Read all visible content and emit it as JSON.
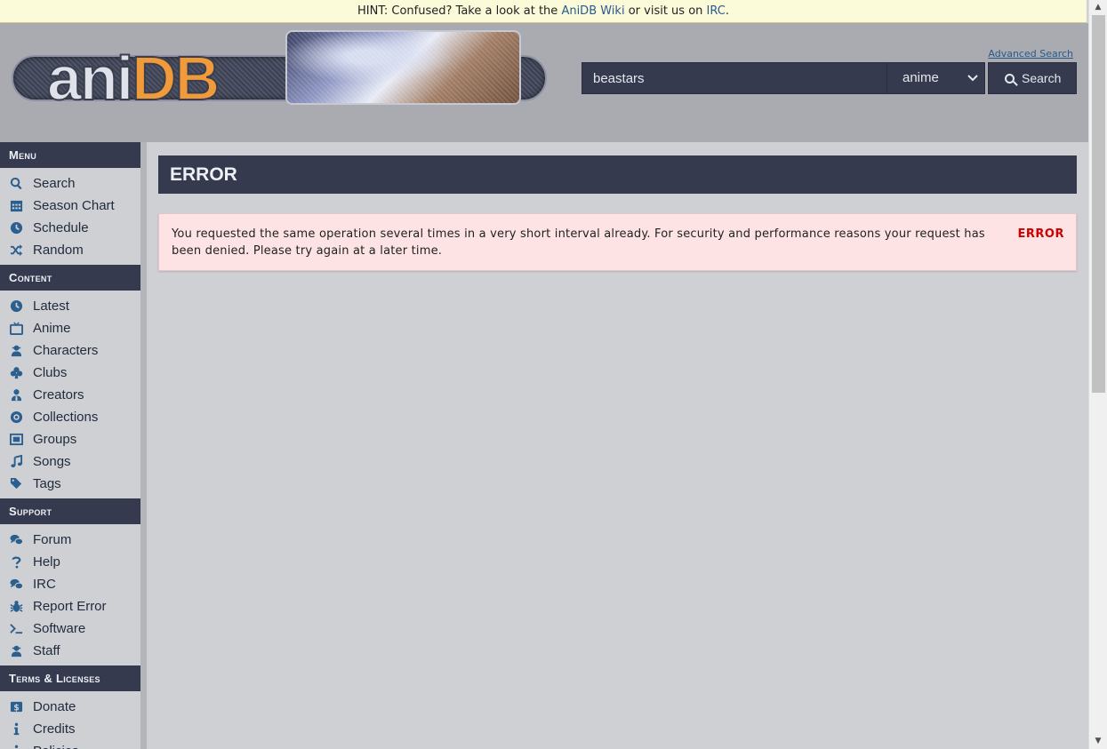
{
  "hint": {
    "prefix": "HINT: Confused? Take a look at the ",
    "wiki_link": "AniDB Wiki",
    "middle": " or visit us on ",
    "irc_link": "IRC",
    "suffix": "."
  },
  "header": {
    "logo_ani": "ani",
    "logo_db": "DB",
    "advanced_search": "Advanced Search",
    "search_value": "beastars",
    "search_type": "anime",
    "search_button": "Search"
  },
  "sidebar": {
    "sections": [
      {
        "title": "Menu",
        "items": [
          {
            "label": "Search",
            "icon": "search-icon"
          },
          {
            "label": "Season Chart",
            "icon": "calendar-grid-icon"
          },
          {
            "label": "Schedule",
            "icon": "clock-icon"
          },
          {
            "label": "Random",
            "icon": "shuffle-icon"
          }
        ]
      },
      {
        "title": "Content",
        "items": [
          {
            "label": "Latest",
            "icon": "clock-icon"
          },
          {
            "label": "Anime",
            "icon": "tv-icon"
          },
          {
            "label": "Characters",
            "icon": "user-secret-icon"
          },
          {
            "label": "Clubs",
            "icon": "club-icon"
          },
          {
            "label": "Creators",
            "icon": "user-tie-icon"
          },
          {
            "label": "Collections",
            "icon": "disc-icon"
          },
          {
            "label": "Groups",
            "icon": "object-group-icon"
          },
          {
            "label": "Songs",
            "icon": "music-icon"
          },
          {
            "label": "Tags",
            "icon": "tags-icon"
          }
        ]
      },
      {
        "title": "Support",
        "items": [
          {
            "label": "Forum",
            "icon": "comments-icon"
          },
          {
            "label": "Help",
            "icon": "question-icon"
          },
          {
            "label": "IRC",
            "icon": "comments-icon"
          },
          {
            "label": "Report Error",
            "icon": "bug-icon"
          },
          {
            "label": "Software",
            "icon": "terminal-icon"
          },
          {
            "label": "Staff",
            "icon": "user-secret-icon"
          }
        ]
      },
      {
        "title": "Terms & Licenses",
        "items": [
          {
            "label": "Donate",
            "icon": "dollar-icon"
          },
          {
            "label": "Credits",
            "icon": "info-icon"
          },
          {
            "label": "Policies",
            "icon": "info-icon"
          }
        ]
      }
    ]
  },
  "main": {
    "title": "ERROR",
    "message": "You requested the same operation several times in a very short interval already. For security and performance reasons your request has been denied. Please try again at a later time.",
    "error_label": "ERROR"
  },
  "colors": {
    "header_dark": "#363a4f",
    "link": "#2a5a8c",
    "error_red": "#cc0000",
    "error_bg": "#fde3e4"
  }
}
